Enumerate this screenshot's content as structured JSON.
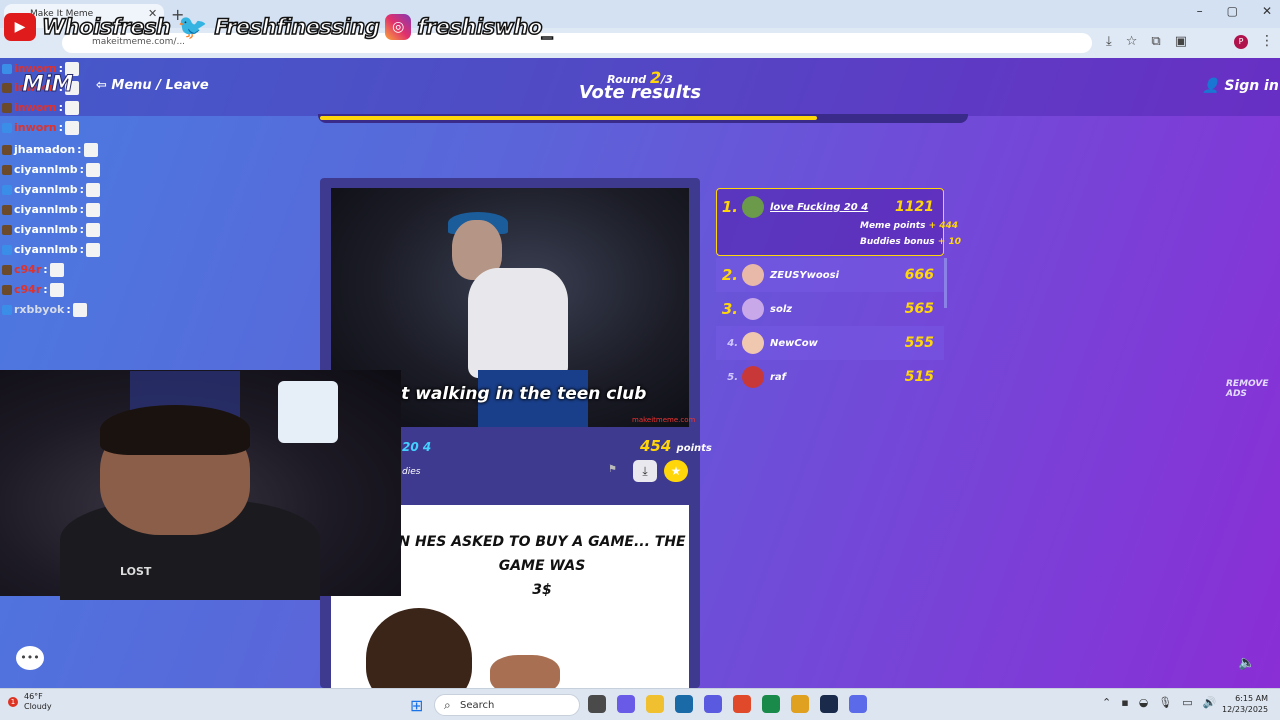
{
  "browser": {
    "tab_title": "Make It Meme",
    "url": "makeitmeme.com/...",
    "profile_initial": "P",
    "window_controls": [
      "–",
      "▢",
      "✕"
    ]
  },
  "overlay": {
    "youtube": "Whoisfresh",
    "twitter": "Freshfinessing",
    "instagram": "freshiswho_",
    "logo": "MiM"
  },
  "chat": [
    {
      "user": "inworn",
      "sep": ":",
      "color": "#e0312b"
    },
    {
      "user": "inworn",
      "sep": ":",
      "color": "#e0312b"
    },
    {
      "user": "inworn",
      "sep": ":",
      "color": "#e0312b"
    },
    {
      "user": "inworn",
      "sep": ":",
      "color": "#e0312b"
    },
    {
      "user": "jhamadon",
      "sep": ":",
      "color": "#ffffff"
    },
    {
      "user": "ciyannlmb",
      "sep": ":",
      "color": "#ffffff"
    },
    {
      "user": "ciyannlmb",
      "sep": ":",
      "color": "#ffffff"
    },
    {
      "user": "ciyannlmb",
      "sep": ":",
      "color": "#ffffff"
    },
    {
      "user": "ciyannlmb",
      "sep": ":",
      "color": "#ffffff"
    },
    {
      "user": "ciyannlmb",
      "sep": ":",
      "color": "#ffffff"
    },
    {
      "user": "c94r",
      "sep": ":",
      "color": "#e0312b"
    },
    {
      "user": "c94r",
      "sep": ":",
      "color": "#e0312b"
    },
    {
      "user": "rxbbyok",
      "sep": ":",
      "color": "#d6dbe8"
    }
  ],
  "header": {
    "menu_leave": "Menu / Leave",
    "round_label": "Round",
    "round_current": "2",
    "round_total": "/3",
    "title": "Vote results",
    "sign_in": "Sign in",
    "progress_fraction": 0.77
  },
  "meme1": {
    "caption": "lost walking in the teen club",
    "watermark": "makeitmeme.com",
    "author_partial": "20 4",
    "buddies_partial": "dies",
    "points": "454",
    "points_label": "points"
  },
  "meme2": {
    "text_line1": "N HES ASKED TO BUY A GAME... THE GAME WAS",
    "text_line2": "3$"
  },
  "leaderboard": {
    "first": {
      "rank": "1.",
      "name": "love Fucking 20 4",
      "score": "1121",
      "meme_points_label": "Meme points",
      "meme_points": "+ 444",
      "buddies_label": "Buddies bonus",
      "buddies": "+ 10",
      "avatar_color": "#6a9a4a"
    },
    "rows": [
      {
        "rank": "2.",
        "name": "ZEUSYwoosi",
        "score": "666",
        "avatar_color": "#e8b8a8"
      },
      {
        "rank": "3.",
        "name": "solz",
        "score": "565",
        "avatar_color": "#c8a8e8"
      },
      {
        "rank": "4.",
        "name": "NewCow",
        "score": "555",
        "avatar_color": "#f0c8b0"
      },
      {
        "rank": "5.",
        "name": "raf",
        "score": "515",
        "avatar_color": "#c83838"
      }
    ]
  },
  "side": {
    "remove_ads": "REMOVE ADS"
  },
  "webcam": {
    "shirt_text": "LOST"
  },
  "taskbar": {
    "weather_badge": "1",
    "temp": "46°F",
    "condition": "Cloudy",
    "search_placeholder": "Search",
    "time": "6:15 AM",
    "date": "12/23/2025",
    "app_colors": [
      "#4a4a4a",
      "#6a5ae8",
      "#f0c030",
      "#1a6aa8",
      "#5a5ae0",
      "#e04a2a",
      "#1a8a4a",
      "#e0a020",
      "#1a2a4a",
      "#5a6ae8"
    ]
  }
}
